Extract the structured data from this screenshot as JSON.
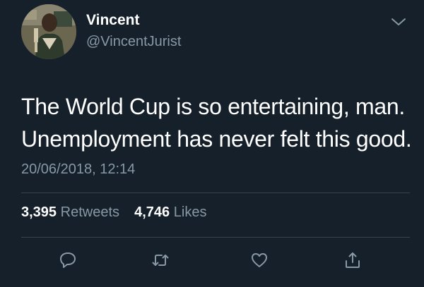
{
  "user": {
    "display_name": "Vincent",
    "handle": "@VincentJurist"
  },
  "tweet": {
    "lines": [
      "The World Cup is so entertaining, man.",
      "Unemployment has never felt this good."
    ],
    "timestamp": "20/06/2018, 12:14"
  },
  "stats": {
    "retweets_count": "3,395",
    "retweets_label": "Retweets",
    "likes_count": "4,746",
    "likes_label": "Likes"
  },
  "icons": {
    "menu": "chevron-down-icon",
    "reply": "reply-icon",
    "retweet": "retweet-icon",
    "like": "heart-icon",
    "share": "share-icon"
  },
  "colors": {
    "background": "#15202b",
    "primary_text": "#ffffff",
    "secondary_text": "#8899a6",
    "divider": "#38444d"
  }
}
